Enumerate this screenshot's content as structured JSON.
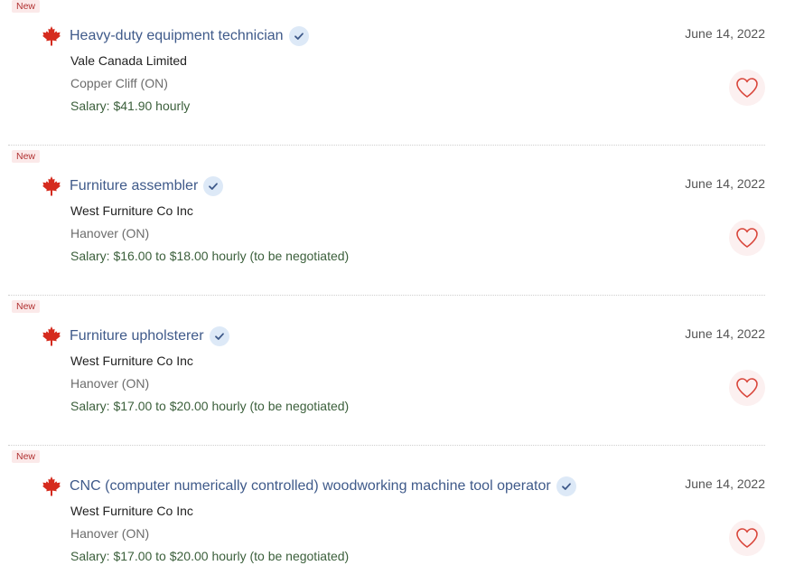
{
  "jobs": [
    {
      "badge": "New",
      "title": "Heavy-duty equipment technician",
      "company": "Vale Canada Limited",
      "location": "Copper Cliff (ON)",
      "salary": "Salary: $41.90 hourly",
      "date": "June 14, 2022"
    },
    {
      "badge": "New",
      "title": "Furniture assembler",
      "company": "West Furniture Co Inc",
      "location": "Hanover (ON)",
      "salary": "Salary: $16.00 to $18.00 hourly (to be negotiated)",
      "date": "June 14, 2022"
    },
    {
      "badge": "New",
      "title": "Furniture upholsterer",
      "company": "West Furniture Co Inc",
      "location": "Hanover (ON)",
      "salary": "Salary: $17.00 to $20.00 hourly (to be negotiated)",
      "date": "June 14, 2022"
    },
    {
      "badge": "New",
      "title": "CNC (computer numerically controlled) woodworking machine tool operator",
      "company": "West Furniture Co Inc",
      "location": "Hanover (ON)",
      "salary": "Salary: $17.00 to $20.00 hourly (to be negotiated)",
      "date": "June 14, 2022"
    }
  ],
  "colors": {
    "title": "#3f5a8a",
    "badge_bg": "#fbe9e9",
    "badge_text": "#b03030",
    "maple_leaf": "#d52b1e",
    "verified_bg": "#dde9f7",
    "verified_check": "#3f5a8a",
    "favorite_heart": "#d9463b"
  },
  "icons": {
    "flag": "maple-leaf-icon",
    "verified": "verified-check-icon",
    "favorite": "heart-icon"
  }
}
